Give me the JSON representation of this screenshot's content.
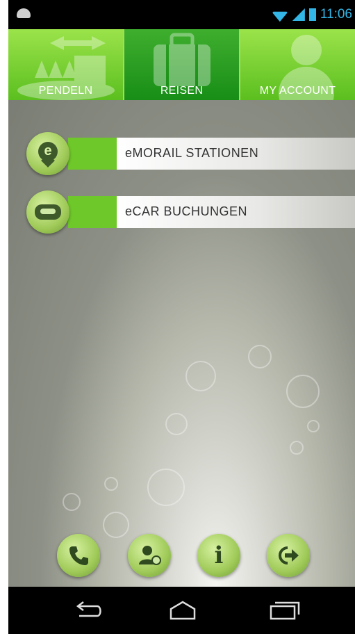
{
  "status_bar": {
    "time": "11:06",
    "icons": [
      "android-notification-icon",
      "wifi-icon",
      "signal-icon",
      "battery-icon"
    ]
  },
  "tabs": [
    {
      "label": "PENDELN",
      "icon": "commute-icon",
      "active": false
    },
    {
      "label": "REISEN",
      "icon": "suitcase-icon",
      "active": true
    },
    {
      "label": "MY ACCOUNT",
      "icon": "person-icon",
      "active": false
    }
  ],
  "menu": [
    {
      "label": "eMORAIL STATIONEN",
      "icon": "location-pin-icon"
    },
    {
      "label": "eCAR BUCHUNGEN",
      "icon": "car-icon"
    }
  ],
  "bottom_buttons": [
    {
      "name": "call-button",
      "icon": "phone-icon"
    },
    {
      "name": "contact-button",
      "icon": "contact-icon"
    },
    {
      "name": "info-button",
      "icon": "info-icon"
    },
    {
      "name": "logout-button",
      "icon": "logout-icon"
    }
  ],
  "nav": {
    "back": "back-icon",
    "home": "home-icon",
    "recent": "recent-apps-icon"
  },
  "colors": {
    "accent_green": "#6fc82a",
    "active_tab": "#188e17",
    "status_blue": "#33b5e5"
  }
}
